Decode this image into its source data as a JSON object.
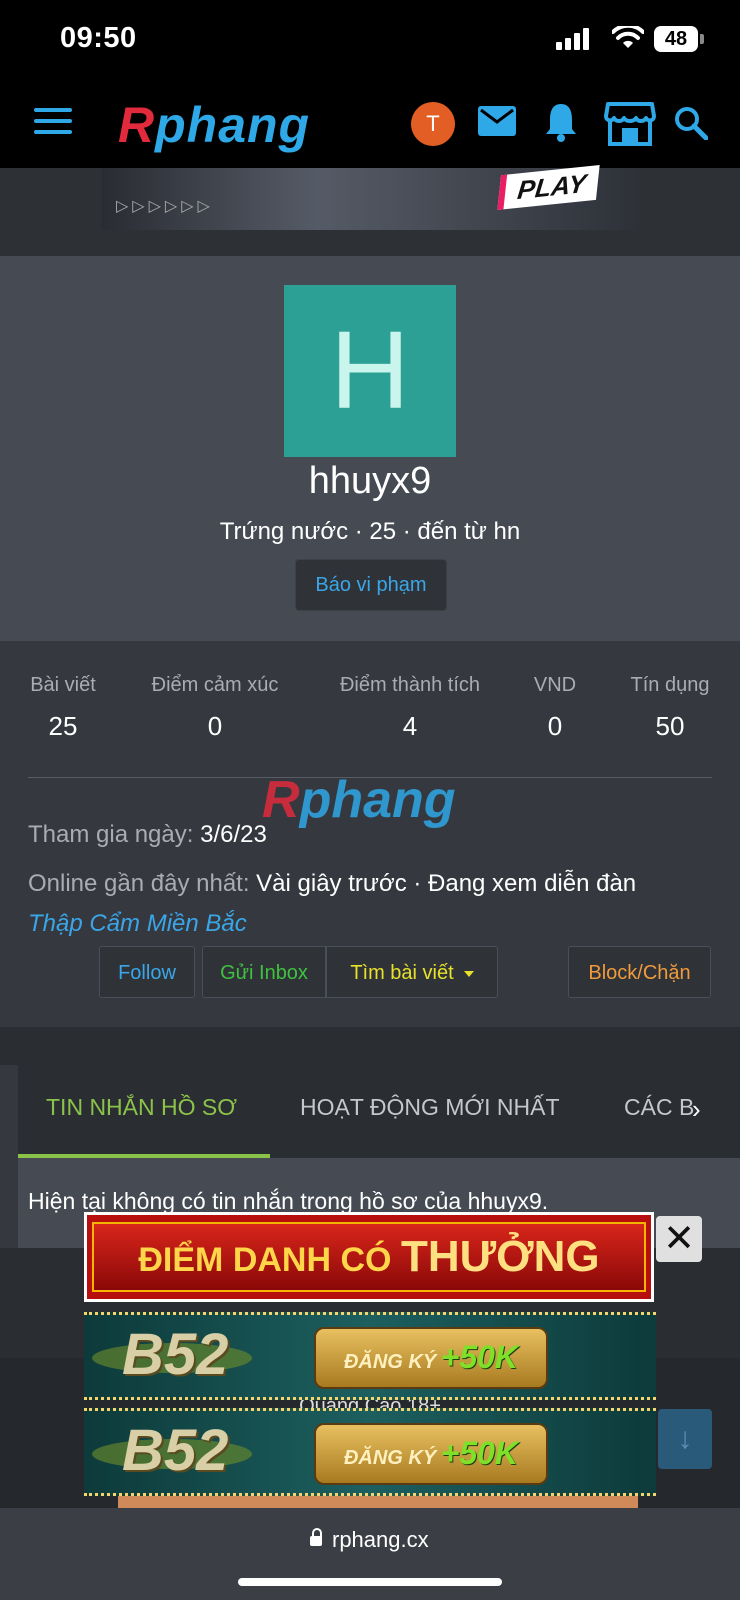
{
  "status_bar": {
    "time": "09:50",
    "battery": "48"
  },
  "nav": {
    "logo_r": "R",
    "logo_rest": "phang",
    "user_initial": "T",
    "icons": [
      "menu-icon",
      "mail-icon",
      "bell-icon",
      "store-icon",
      "search-icon"
    ]
  },
  "top_banner": {
    "text": "PLAY",
    "arrows": "▷▷▷▷▷▷"
  },
  "profile": {
    "avatar_letter": "H",
    "username": "hhuyx9",
    "meta": "Trứng nước · 25 · đến từ hn",
    "report_label": "Báo vi phạm"
  },
  "stats": [
    {
      "label": "Bài viết",
      "value": "25"
    },
    {
      "label": "Điểm cảm xúc",
      "value": "0"
    },
    {
      "label": "Điểm thành tích",
      "value": "4"
    },
    {
      "label": "VND",
      "value": "0"
    },
    {
      "label": "Tín dụng",
      "value": "50"
    }
  ],
  "watermark": {
    "r": "R",
    "rest": "phang"
  },
  "details": {
    "joined_label": "Tham gia ngày:",
    "joined_value": "3/6/23",
    "online_label": "Online gần đây nhất:",
    "online_value": "Vài giây trước · Đang xem diễn đàn",
    "forum_link": "Thập Cẩm Miền Bắc"
  },
  "actions": {
    "follow": "Follow",
    "inbox": "Gửi Inbox",
    "find": "Tìm bài viết",
    "block": "Block/Chặn"
  },
  "tabs": {
    "items": [
      "TIN NHẮN HỒ SƠ",
      "HOẠT ĐỘNG MỚI NHẤT",
      "CÁC B"
    ],
    "more": "›"
  },
  "profile_messages": {
    "empty_text": "Hiện tại không có tin nhắn trong hồ sơ của hhuyx9."
  },
  "ads": {
    "label": "Quảng Cáo 18+",
    "checkin_a": "ĐIỂM DANH CÓ ",
    "checkin_b": "THƯỞNG",
    "close": "✕",
    "b52": "B52",
    "register": "ĐĂNG KÝ",
    "bonus": "+50K"
  },
  "url_bar": {
    "url": "rphang.cx"
  }
}
